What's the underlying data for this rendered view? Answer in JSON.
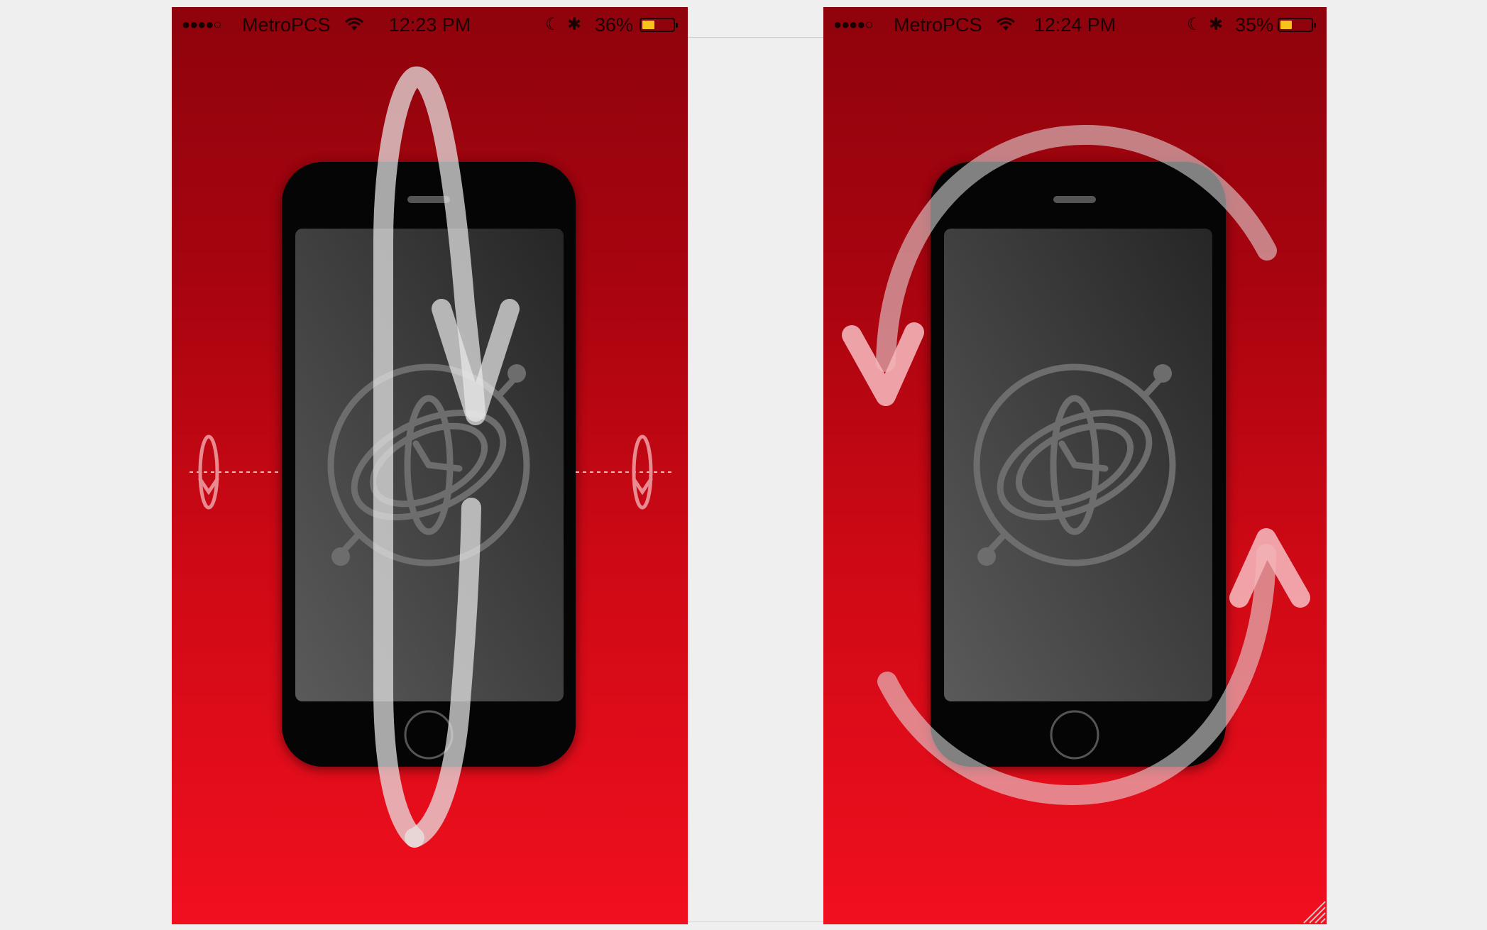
{
  "screens": [
    {
      "status": {
        "signal": "●●●●○",
        "carrier": "MetroPCS",
        "time": "12:23 PM",
        "battery_percent": "36%",
        "battery_level": 0.36
      },
      "gesture": "rotate about horizontal axis"
    },
    {
      "status": {
        "signal": "●●●●○",
        "carrier": "MetroPCS",
        "time": "12:24 PM",
        "battery_percent": "35%",
        "battery_level": 0.35
      },
      "gesture": "rotate in screen plane"
    }
  ],
  "icons": {
    "moon": "☾",
    "bluetooth": "✱",
    "app_logo": "gyroscope-icon"
  },
  "colors": {
    "background_top": "#8f030c",
    "background_bottom": "#f10f1e",
    "battery_fill": "#f7c21a",
    "arrow_white": "#d8d8d8",
    "arrow_pink": "#f4b4b8"
  }
}
